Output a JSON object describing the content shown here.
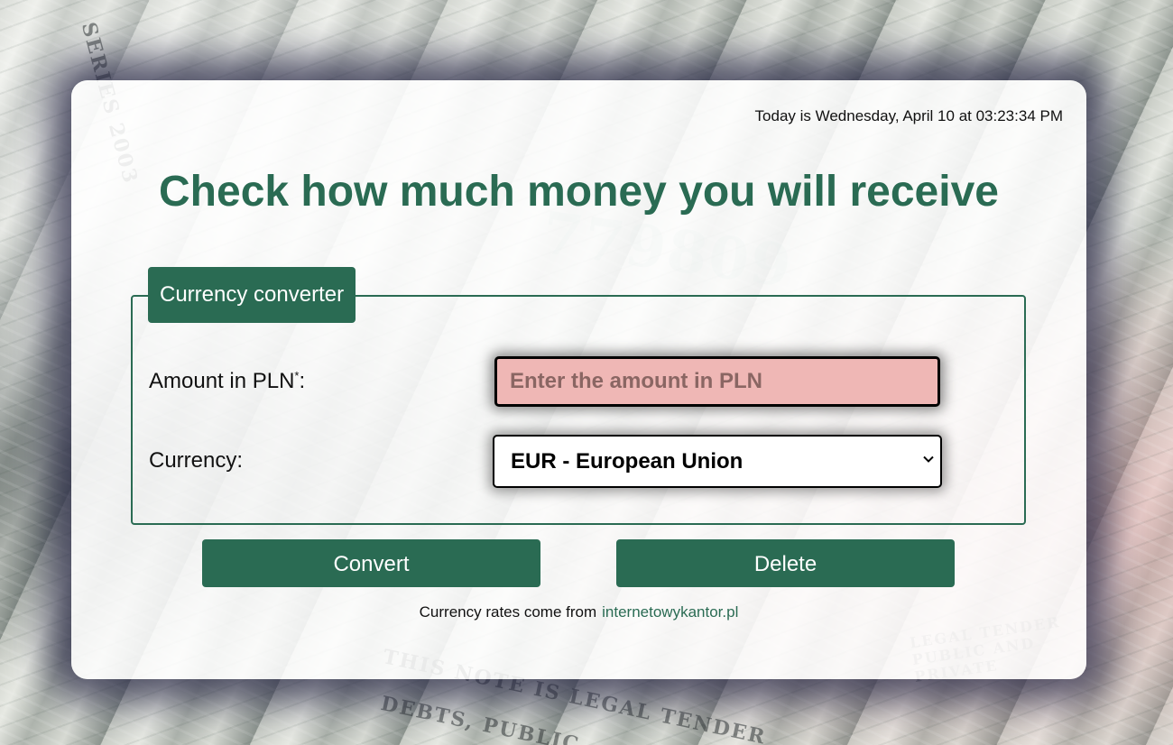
{
  "background": {
    "series_text": "SERIES 2003",
    "legal_tender_text": "THIS NOTE IS LEGAL TENDER",
    "debts_text": "DEBTS, PUBLIC",
    "serial_number": "779809",
    "side_text": "LEGAL TENDER PUBLIC AND PRIVATE"
  },
  "header": {
    "date_text": "Today is Wednesday, April 10 at 03:23:34 PM",
    "title": "Check how much money you will receive"
  },
  "form": {
    "legend": "Currency converter",
    "amount_label": "Amount in PLN",
    "amount_required_mark": "*",
    "amount_colon": ":",
    "amount_placeholder": "Enter the amount in PLN",
    "amount_value": "",
    "currency_label": "Currency:",
    "currency_selected": "EUR - European Union"
  },
  "buttons": {
    "convert": "Convert",
    "delete": "Delete"
  },
  "footer": {
    "text": "Currency rates come from",
    "link": "internetowykantor.pl"
  },
  "colors": {
    "accent": "#2a6b53",
    "input_invalid_bg": "#efb7b5",
    "card_bg": "#ffffff",
    "shadow": "#28284a"
  },
  "icons": {
    "select_arrow": "chevron-down-icon"
  }
}
